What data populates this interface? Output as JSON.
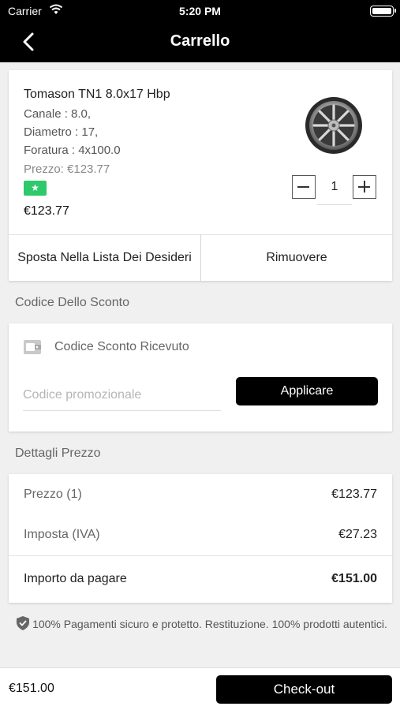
{
  "status_bar": {
    "carrier": "Carrier",
    "time": "5:20 PM",
    "battery_level": 1.0
  },
  "nav": {
    "title": "Carrello",
    "back_icon": "chevron-left-icon"
  },
  "product": {
    "name": "Tomason TN1 8.0x17 Hbp",
    "specs": [
      "Canale : 8.0,",
      "Diametro : 17,",
      "Foratura : 4x100.0"
    ],
    "price_label": "Prezzo: €123.77",
    "badge": "★",
    "final_price": "€123.77",
    "image_icon": "alloy-wheel-image",
    "quantity": "1",
    "wishlist_label": "Sposta Nella Lista Dei Desideri",
    "remove_label": "Rimuovere"
  },
  "discount": {
    "section_title": "Codice Dello Sconto",
    "received_label": "Codice Sconto Ricevuto",
    "promo_placeholder": "Codice promozionale",
    "promo_value": "",
    "apply_label": "Applicare"
  },
  "price_details": {
    "section_title": "Dettagli Prezzo",
    "rows": [
      {
        "label": "Prezzo (1)",
        "value": "€123.77"
      },
      {
        "label": "Imposta (IVA)",
        "value": "€27.23"
      },
      {
        "label": "Importo da pagare",
        "value": "€151.00"
      }
    ]
  },
  "secure_note": "100% Pagamenti sicuro e protetto. Restituzione. 100% prodotti autentici.",
  "footer": {
    "total": "€151.00",
    "checkout_label": "Check-out"
  },
  "colors": {
    "bar": "#000000",
    "badge": "#2dc96b",
    "background": "#f0f0f0"
  }
}
